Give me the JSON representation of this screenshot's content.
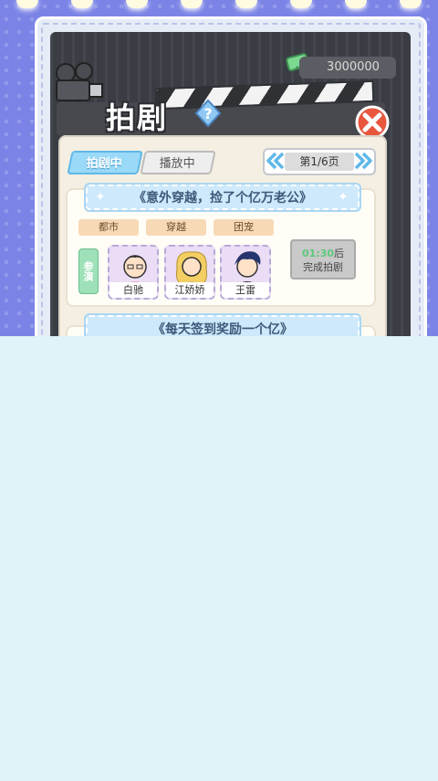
{
  "header": {
    "title": "拍剧",
    "coins": "3000000"
  },
  "tabs": [
    {
      "label": "拍剧中",
      "active": true
    },
    {
      "label": "播放中",
      "active": false
    }
  ],
  "pager": {
    "text": "第1/6页"
  },
  "shows": [
    {
      "title": "《意外穿越，捡了个亿万老公》",
      "tags": [
        "都市",
        "穿越",
        "团宠"
      ],
      "cast_label": "参演",
      "actors": [
        {
          "name": "白驰",
          "hair": "#2b2b2b",
          "shirt": "#f0a6b6"
        },
        {
          "name": "江娇娇",
          "hair": "#f3cf63",
          "shirt": "#ffffff"
        },
        {
          "name": "王雷",
          "hair": "#26356e",
          "shirt": "#2b2b33"
        }
      ],
      "timer": "01:30",
      "timer_suffix": "后",
      "status": "完成拍剧"
    },
    {
      "title": "《每天签到奖励一个亿》"
    }
  ],
  "colors": {
    "backdrop": "#7b84e6",
    "accent": "#9ad9f7",
    "close": "#e8563e",
    "bottom": "#dff3f8"
  }
}
